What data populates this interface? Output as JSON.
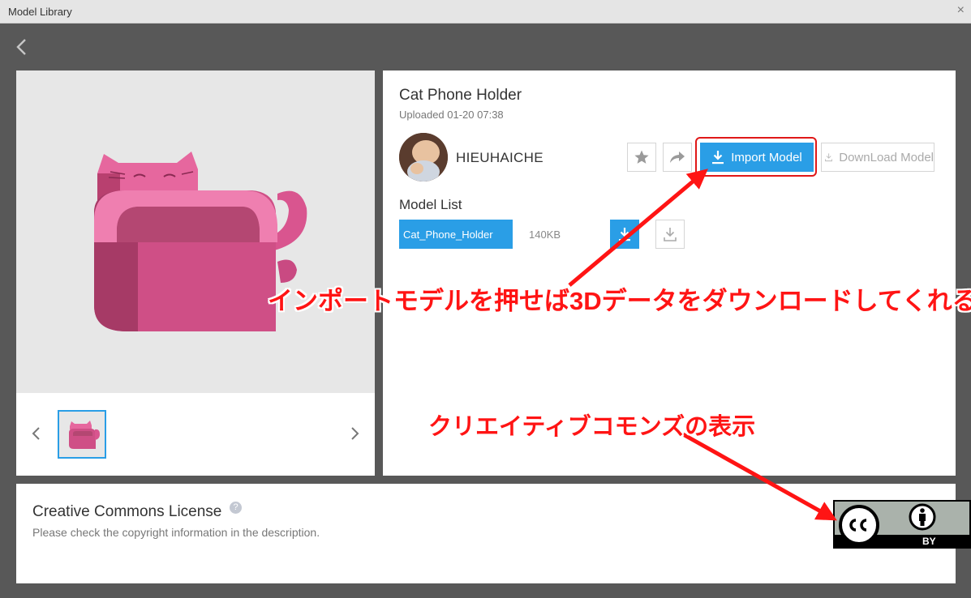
{
  "window": {
    "title": "Model Library",
    "close_symbol": "×"
  },
  "model": {
    "title": "Cat Phone Holder",
    "uploaded": "Uploaded 01-20 07:38",
    "author": "HIEUHAICHE",
    "import_label": "Import Model",
    "download_label": "DownLoad Model"
  },
  "model_list": {
    "label": "Model List",
    "files": [
      {
        "name": "Cat_Phone_Holder",
        "size": "140KB"
      }
    ]
  },
  "license": {
    "title": "Creative Commons License",
    "help_symbol": "?",
    "description": "Please check the copyright information in the description.",
    "badge_text": "BY"
  },
  "annotations": {
    "import_note": "インポートモデルを押せば3Dデータをダウンロードしてくれる",
    "cc_note": "クリエイティブコモンズの表示"
  },
  "colors": {
    "accent": "#2a9ee6",
    "highlight": "#e01818",
    "model_pink": "#d9558f"
  },
  "icons": [
    "back-chevron-icon",
    "close-icon",
    "star-icon",
    "share-icon",
    "import-icon",
    "download-icon",
    "help-icon",
    "cc-icon",
    "attribution-icon"
  ]
}
